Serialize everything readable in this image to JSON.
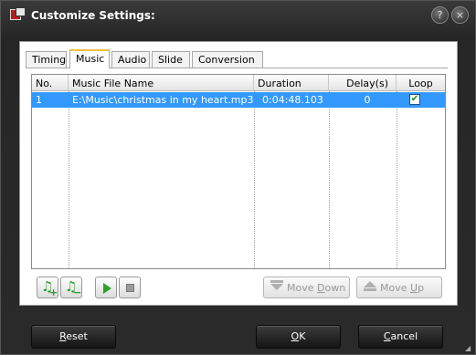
{
  "window": {
    "title": "Customize Settings:",
    "help_glyph": "?",
    "close_glyph": "×",
    "icons": [
      "app-icon",
      "help-icon",
      "close-icon"
    ]
  },
  "tabs": [
    {
      "label": "Timing",
      "active": false
    },
    {
      "label": "Music",
      "active": true
    },
    {
      "label": "Audio",
      "active": false
    },
    {
      "label": "Slide",
      "active": false
    },
    {
      "label": "Conversion",
      "active": false
    }
  ],
  "table": {
    "columns": [
      "No.",
      "Music File Name",
      "Duration",
      "Delay(s)",
      "Loop"
    ],
    "rows": [
      {
        "no": "1",
        "file": "E:\\Music\\christmas in my heart.mp3",
        "duration": "0:04:48.103",
        "delay": "0",
        "loop": true
      }
    ]
  },
  "toolbar": {
    "add_music_icon": "add-music-icon",
    "remove_music_icon": "remove-music-icon",
    "play_icon": "play-icon",
    "stop_icon": "stop-icon",
    "move_down_pre": "Move ",
    "move_down_key": "D",
    "move_down_post": "own",
    "move_up_pre": "Move ",
    "move_up_key": "U",
    "move_up_post": "p",
    "check_glyph": "✔",
    "add_glyph": "+",
    "remove_glyph": "−",
    "note_glyph": "♫"
  },
  "footer": {
    "reset_key": "R",
    "reset_rest": "eset",
    "ok_key": "O",
    "ok_rest": "K",
    "cancel_key": "C",
    "cancel_rest": "ancel"
  },
  "colors": {
    "selection": "#3399ff",
    "window_bg": "#262626",
    "icon_green": "#2a9a2a"
  }
}
